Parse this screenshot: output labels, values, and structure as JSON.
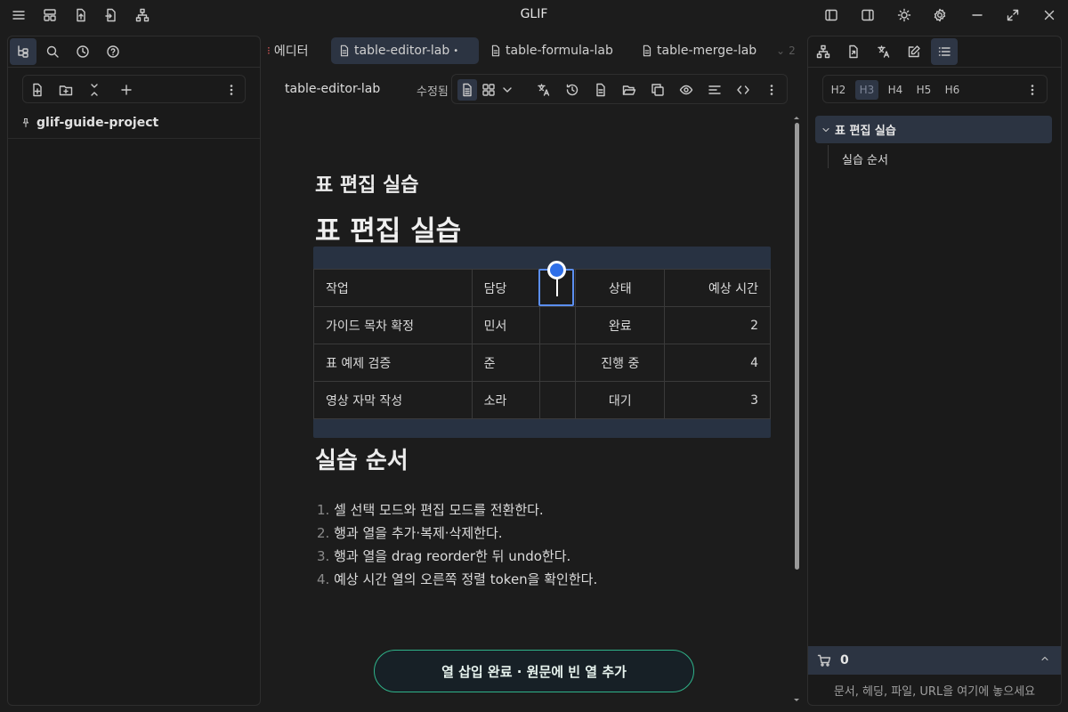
{
  "app": {
    "title": "GLIF"
  },
  "tabs": [
    {
      "label": "에디터",
      "active": false
    },
    {
      "label": "table-editor-lab",
      "active": true,
      "modified_mark": "•"
    },
    {
      "label": "table-formula-lab",
      "active": false
    },
    {
      "label": "table-merge-lab",
      "active": false
    }
  ],
  "tabs_overflow": "2",
  "left": {
    "project": "glif-guide-project"
  },
  "doc": {
    "name": "table-editor-lab",
    "status": "수정됨",
    "h3": "표 편집 실습",
    "h1": "표 편집 실습",
    "h2": "실습 순서",
    "table": {
      "header": [
        "작업",
        "담당",
        "",
        "상태",
        "예상 시간"
      ],
      "rows": [
        [
          "가이드 목차 확정",
          "민서",
          "",
          "완료",
          "2"
        ],
        [
          "표 예제 검증",
          "준",
          "",
          "진행 중",
          "4"
        ],
        [
          "영상 자막 작성",
          "소라",
          "",
          "대기",
          "3"
        ]
      ]
    },
    "steps": [
      {
        "n": "1.",
        "text": "셀 선택 모드와 편집 모드를 전환한다."
      },
      {
        "n": "2.",
        "text": "행과 열을 추가·복제·삭제한다."
      },
      {
        "n": "3.",
        "text": "행과 열을 drag reorder한 뒤 undo한다."
      },
      {
        "n": "4.",
        "text": "예상 시간 열의 오른쪽 정렬 token을 확인한다."
      }
    ]
  },
  "toast": "열 삽입 완료 · 원문에 빈 열 추가",
  "right": {
    "heading_levels": [
      "H2",
      "H3",
      "H4",
      "H5",
      "H6"
    ],
    "outline": [
      {
        "label": "표 편집 실습",
        "level": 1
      },
      {
        "label": "실습 순서",
        "level": 2
      }
    ],
    "cart_count": "0",
    "drop_hint": "문서, 헤딩, 파일, URL을 여기에 놓으세요"
  },
  "colors": {
    "accent": "#2f6fe8",
    "toast_border": "#2fb38a",
    "active_bg": "#2c3442"
  }
}
